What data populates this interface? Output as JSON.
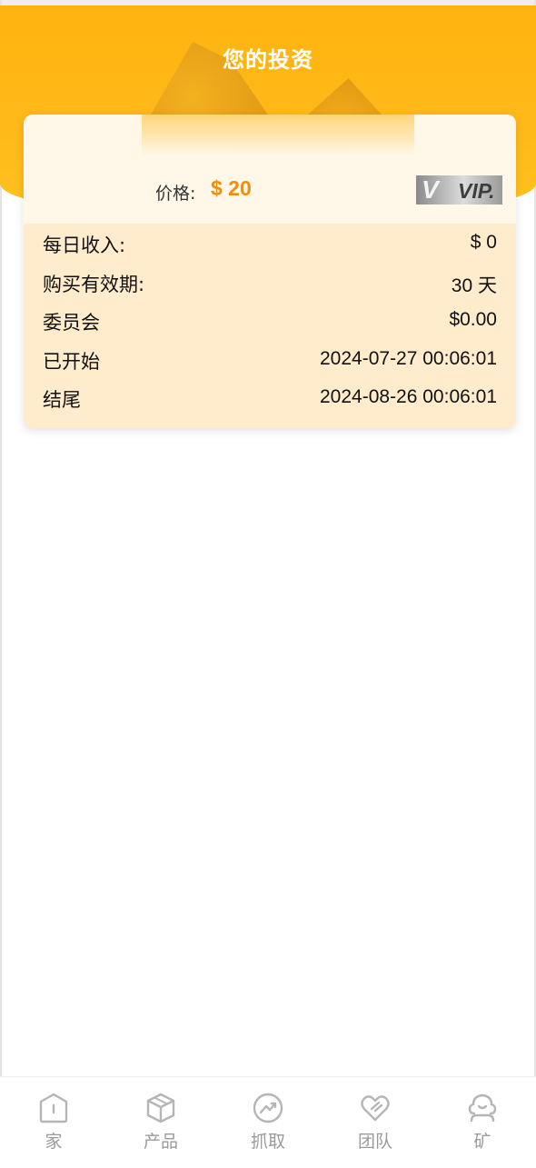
{
  "header": {
    "title": "您的投资"
  },
  "card": {
    "price_label": "价格:",
    "price_value": "$ 20",
    "badge": {
      "mark": "V",
      "text": "VIP."
    },
    "rows": [
      {
        "label": "每日收入:",
        "value": "$ 0"
      },
      {
        "label": "购买有效期:",
        "value": "30 天"
      },
      {
        "label": "委员会",
        "value": "$0.00"
      },
      {
        "label": "已开始",
        "value": "2024-07-27 00:06:01"
      },
      {
        "label": "结尾",
        "value": "2024-08-26 00:06:01"
      }
    ]
  },
  "nav": {
    "items": [
      {
        "label": "家",
        "icon": "home-icon"
      },
      {
        "label": "产品",
        "icon": "box-icon"
      },
      {
        "label": "抓取",
        "icon": "trend-icon"
      },
      {
        "label": "团队",
        "icon": "team-heart-icon"
      },
      {
        "label": "矿",
        "icon": "mine-icon"
      }
    ]
  },
  "colors": {
    "header": "#ffb30f",
    "price": "#f28d0c",
    "card_body": "#ffeccc",
    "card_top": "#fff7e8",
    "nav_text": "#9a9a9a"
  }
}
